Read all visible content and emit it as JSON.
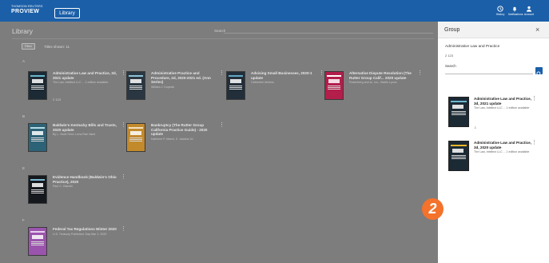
{
  "brand": {
    "line1": "THOMSON REUTERS",
    "line2": "PROVIEW"
  },
  "nav": {
    "library_label": "Library"
  },
  "top_icons": [
    {
      "icon": "history-icon",
      "label": "History"
    },
    {
      "icon": "bell-icon",
      "label": "Notifications"
    },
    {
      "icon": "person-icon",
      "label": "Account"
    }
  ],
  "main": {
    "title": "Library",
    "search_label": "Search",
    "filter_label": "Filter",
    "titles_shown": "Titles shown: 11",
    "sections": [
      "A",
      "B",
      "E",
      "F"
    ],
    "cards": [
      {
        "title": "Administrative Law and Practice, 3d, 2021 update",
        "sub": "The Law, Intellect LLC ... 1 edition available",
        "meta": "2   123",
        "cover": "#1b2a35",
        "accent": "#6ab7cf"
      },
      {
        "title": "Administrative Practice and Procedure, 2d, 2020-2021 ed. (Ann Series)",
        "sub": "William J. Kopecki",
        "meta": "",
        "cover": "#2a3742",
        "accent": "#8ec2d8"
      },
      {
        "title": "Advising Small Businesses, 2020-1 update",
        "sub": "Cathedral Jenkins",
        "meta": "",
        "cover": "#222f3a",
        "accent": "#63a8c4"
      },
      {
        "title": "Alternative Dispute Resolution (The Rutter Group Calif... 2020 update",
        "sub": "Rosenberg and al., Inc., Martin Lyons",
        "meta": "",
        "cover": "#b31e4b",
        "accent": "#ffffff"
      },
      {
        "title": "Baldwin's Kentucky Bills and Trusts, 2020 update",
        "sub": "By L. Scott Gerd, Lena Rae Vand",
        "meta": "",
        "cover": "#2d6377",
        "accent": "#b7dbe6"
      },
      {
        "title": "Bankruptcy (The Rutter Group California Practice Guide) - 2020 update",
        "sub": "Kathleen P. March, E. Jaskins 2d",
        "meta": "",
        "cover": "#c38a2c",
        "accent": "#f3e2be"
      },
      {
        "title": "Evidence Handbook (Baldwin's Ohio Practice), 2020",
        "sub": "Paul C. Gianelli",
        "meta": "",
        "cover": "#15181d",
        "accent": "#7bb8d2"
      },
      {
        "title": "Federal Tax Regulations Winter 2020",
        "sub": "U.S. Treasury Published: Day Mar 1, 2020",
        "meta": "",
        "cover": "#9b54ad",
        "accent": "#e7cff0"
      }
    ]
  },
  "panel": {
    "title": "Group",
    "close": "×",
    "group_name": "Administrative Law and Practice",
    "meta": "2   123",
    "search_label": "Search",
    "search_placeholder": "",
    "items": [
      {
        "title": "Administrative Law and Practice, 3d, 2021 update",
        "sub": "The Law, Intellect LLC ... 1 edition available",
        "meta": "",
        "cover": "#1b2a35",
        "accent": "#6ab7cf"
      },
      {
        "title": "Administrative Law and Practice, 3d, 2020 update",
        "sub": "The Law, Intellect LLC ... 1 edition available",
        "meta": "",
        "cover": "#1b2a35",
        "accent": "#e8b52a"
      }
    ]
  },
  "step_badge": "2",
  "colors": {
    "topbar": "#1b5fa8",
    "overlay": "#7d7d7d",
    "badge": "#f4722b"
  }
}
